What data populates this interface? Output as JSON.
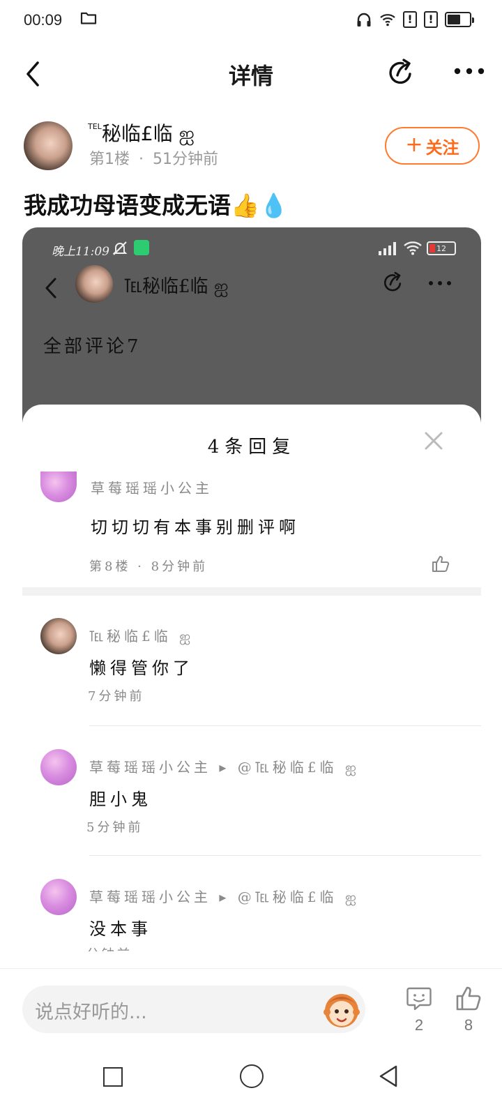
{
  "status_bar": {
    "time": "00:09",
    "battery_level": 0.6,
    "icons": [
      "folder-icon",
      "headphones-icon",
      "wifi-icon",
      "alert-icon",
      "alert-icon",
      "battery-icon"
    ]
  },
  "nav": {
    "title": "详情",
    "icons": [
      "back-icon",
      "share-icon",
      "more-icon"
    ]
  },
  "post": {
    "author_prefix": "TEL",
    "author_name": "秘临£临 ஐ",
    "floor_label": "第1楼",
    "separator": "·",
    "time_ago": "51分钟前",
    "follow_label": "关注",
    "follow_plus": "+",
    "text": "我成功母语变成无语👍💧"
  },
  "screenshot": {
    "status_time": "晚上11:09",
    "battery": "12",
    "author": "℡秘临£临 ஐ",
    "all_comments": "全部评论7",
    "sheet_title": "4条回复",
    "replies": [
      {
        "name": "草莓瑶瑶小公主",
        "text": "切切切有本事别删评啊",
        "time": "第8楼 · 8分钟前"
      },
      {
        "name": "℡秘临£临 ஐ",
        "text": "懒得管你了",
        "time": "7分钟前"
      },
      {
        "name": "草莓瑶瑶小公主 ▸ @℡秘临£临 ஐ",
        "text": "胆小鬼",
        "time": "5分钟前"
      },
      {
        "name": "草莓瑶瑶小公主 ▸ @℡秘临£临 ஐ",
        "text": "没本事",
        "time": "分钟前"
      }
    ]
  },
  "bottom_bar": {
    "input_placeholder": "说点好听的...",
    "comment_count": "2",
    "like_count": "8"
  },
  "colors": {
    "accent": "#ff6a1a",
    "screenshot_header": "#5c5c5c"
  }
}
